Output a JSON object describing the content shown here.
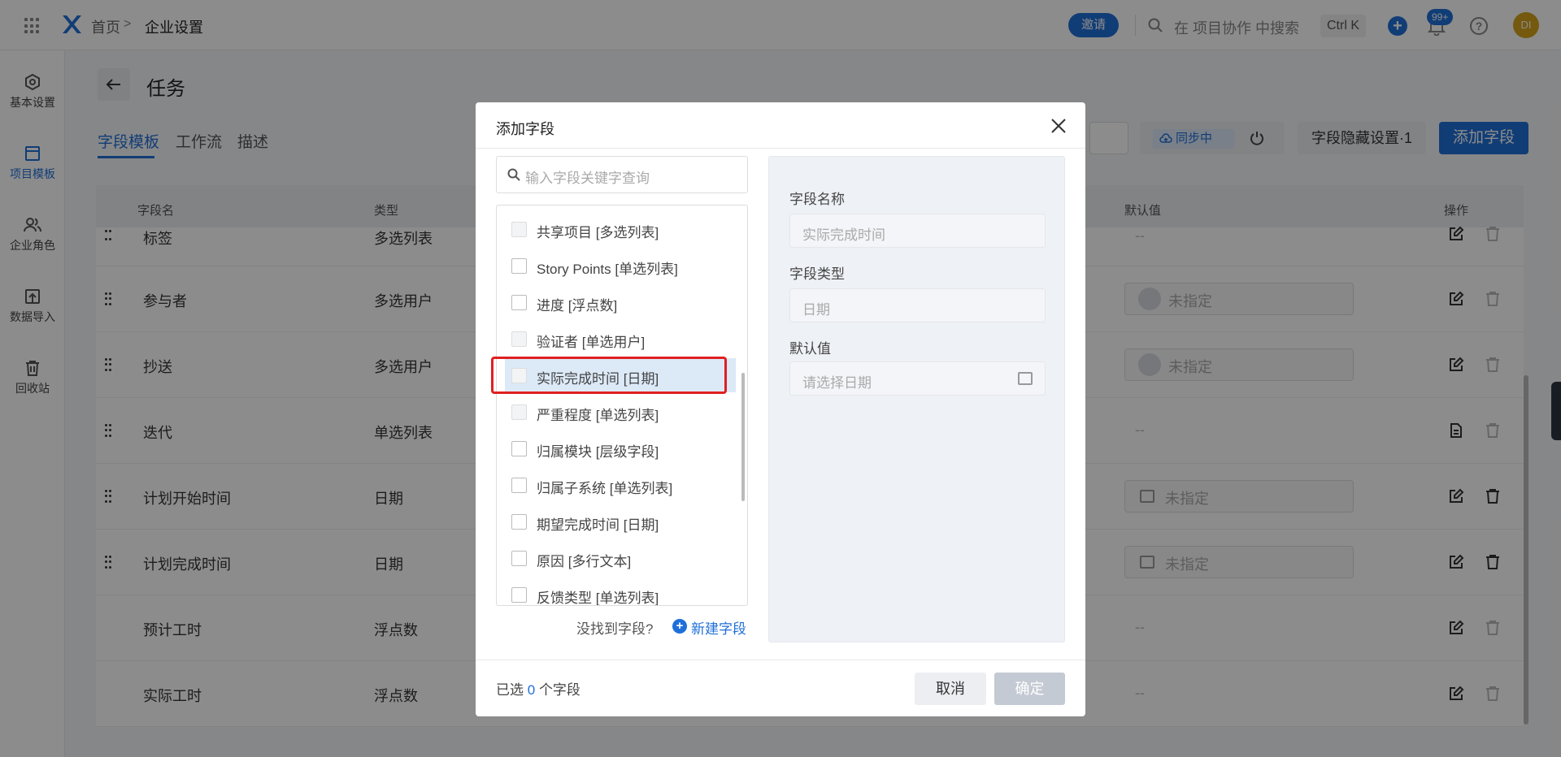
{
  "topbar": {
    "breadcrumb_home": "首页",
    "breadcrumb_sep": ">",
    "breadcrumb_current": "企业设置",
    "invite_label": "邀请",
    "search_text": "在 项目协作 中搜索",
    "shortcut": "Ctrl K",
    "plus_label": "+",
    "notification_badge": "99+",
    "help_label": "?",
    "avatar_initials": "DI",
    "accent_color": "#1f6fd8"
  },
  "sidenav": {
    "items": [
      {
        "label": "基本设置",
        "icon": "gear-icon"
      },
      {
        "label": "项目模板",
        "icon": "template-icon"
      },
      {
        "label": "企业角色",
        "icon": "users-icon"
      },
      {
        "label": "数据导入",
        "icon": "import-icon"
      },
      {
        "label": "回收站",
        "icon": "trash-icon"
      }
    ]
  },
  "main": {
    "title": "任务",
    "tabs": [
      "字段模板",
      "工作流",
      "描述"
    ],
    "sync_label": "同步中",
    "hide_label": "字段隐藏设置·1",
    "add_field_label": "添加字段",
    "table": {
      "headers": {
        "name": "字段名",
        "type": "类型",
        "default": "默认值",
        "action": "操作"
      },
      "rows": [
        {
          "name": "标签",
          "type": "多选列表",
          "default": "--"
        },
        {
          "name": "参与者",
          "type": "多选用户",
          "default": "未指定"
        },
        {
          "name": "抄送",
          "type": "多选用户",
          "default": "未指定"
        },
        {
          "name": "迭代",
          "type": "单选列表",
          "default": "--"
        },
        {
          "name": "计划开始时间",
          "type": "日期",
          "default": "未指定"
        },
        {
          "name": "计划完成时间",
          "type": "日期",
          "default": "未指定"
        },
        {
          "name": "预计工时",
          "type": "浮点数",
          "default": "--"
        },
        {
          "name": "实际工时",
          "type": "浮点数",
          "default": "--"
        }
      ]
    }
  },
  "modal": {
    "title": "添加字段",
    "search_placeholder": "输入字段关键字查询",
    "fields": [
      {
        "label": "共享项目 [多选列表]",
        "disabled": true
      },
      {
        "label": "Story Points [单选列表]",
        "disabled": false
      },
      {
        "label": "进度 [浮点数]",
        "disabled": false
      },
      {
        "label": "验证者 [单选用户]",
        "disabled": true
      },
      {
        "label": "实际完成时间 [日期]",
        "disabled": true,
        "highlighted": true
      },
      {
        "label": "严重程度 [单选列表]",
        "disabled": true
      },
      {
        "label": "归属模块 [层级字段]",
        "disabled": false
      },
      {
        "label": "归属子系统 [单选列表]",
        "disabled": false
      },
      {
        "label": "期望完成时间 [日期]",
        "disabled": false
      },
      {
        "label": "原因 [多行文本]",
        "disabled": false
      },
      {
        "label": "反馈类型 [单选列表]",
        "disabled": false
      }
    ],
    "not_found": "没找到字段?",
    "new_field": "新建字段",
    "detail": {
      "name_label": "字段名称",
      "name_value": "实际完成时间",
      "type_label": "字段类型",
      "type_value": "日期",
      "default_label": "默认值",
      "default_placeholder": "请选择日期"
    },
    "selected_prefix": "已选",
    "selected_count": "0",
    "selected_suffix": "个字段",
    "cancel": "取消",
    "confirm": "确定"
  }
}
